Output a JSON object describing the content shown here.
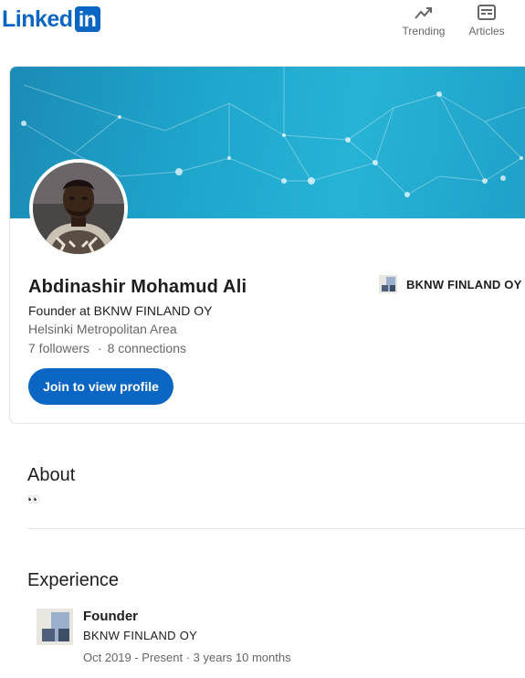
{
  "nav": {
    "logo_text": "Linked",
    "logo_box": "in",
    "trending_label": "Trending",
    "articles_label": "Articles"
  },
  "profile": {
    "name": "Abdinashir Mohamud Ali",
    "headline": "Founder at BKNW FINLAND OY",
    "location": "Helsinki Metropolitan Area",
    "followers": "7 followers",
    "separator": "·",
    "connections": "8 connections",
    "join_button_label": "Join to view profile",
    "current_company": "BKNW FINLAND OY"
  },
  "about": {
    "title": "About",
    "text": "👀"
  },
  "experience": {
    "title": "Experience",
    "items": [
      {
        "title": "Founder",
        "company": "BKNW FINLAND OY",
        "dates": "Oct 2019 - Present · 3 years 10 months"
      }
    ]
  },
  "colors": {
    "brand_blue": "#0a66c2",
    "banner_teal": "#1ea5cc",
    "muted_text": "#666666"
  },
  "icons": [
    "trending-icon",
    "articles-icon",
    "company-logo-icon"
  ]
}
